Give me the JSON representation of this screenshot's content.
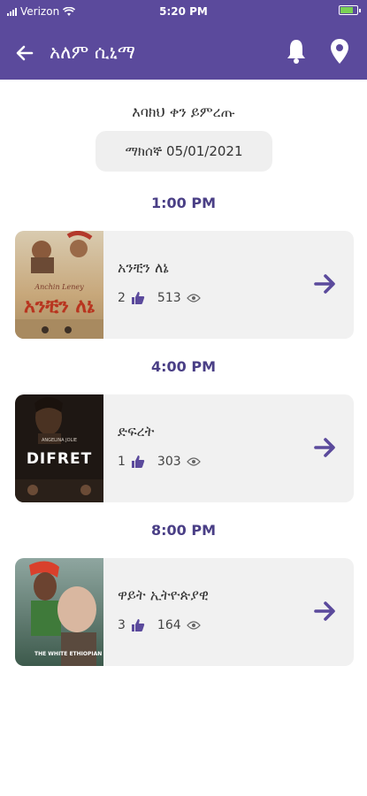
{
  "status_bar": {
    "carrier": "Verizon",
    "time": "5:20 PM"
  },
  "header": {
    "title": "አለም ሲኒማ"
  },
  "select_day_label": "እባክህ ቀን ይምረጡ",
  "date_label": "ማክሰኞ 05/01/2021",
  "showtimes": [
    {
      "time": "1:00 PM",
      "title": "አንቺን ለኔ",
      "likes": "2",
      "views": "513"
    },
    {
      "time": "4:00 PM",
      "title": "ድፍረት",
      "likes": "1",
      "views": "303"
    },
    {
      "time": "8:00 PM",
      "title": "ዋይት ኢትዮጵያዊ",
      "likes": "3",
      "views": "164"
    }
  ],
  "posters": [
    {
      "title_text": "አንቺን ለኔ",
      "subtitle": "Anchin Leney"
    },
    {
      "title_text": "DIFRET",
      "subtitle": "ANGELINA JOLIE"
    },
    {
      "title_text": "THE WHITE ETHIOPIAN"
    }
  ],
  "colors": {
    "brand": "#5b4a9c",
    "time_label": "#4a3f86",
    "card_bg": "#f1f1f1"
  }
}
